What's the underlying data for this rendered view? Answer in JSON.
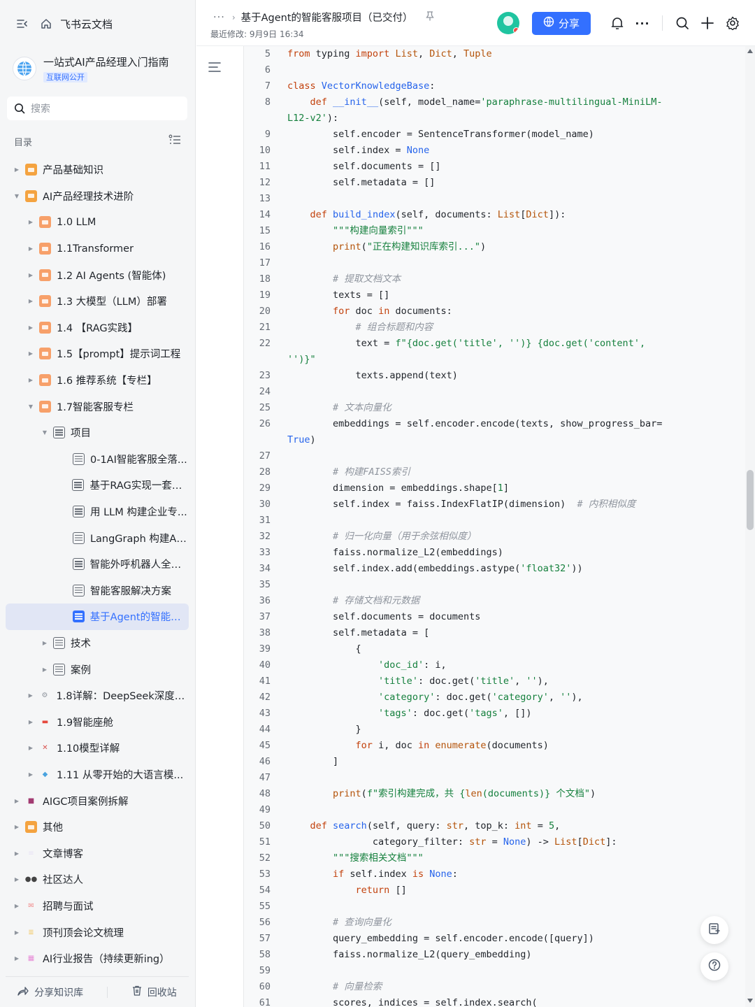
{
  "sidebar": {
    "brand": "飞书云文档",
    "workspace_title": "一站式AI产品经理入门指南",
    "workspace_badge": "互联网公开",
    "search_placeholder": "搜索",
    "toc_label": "目录",
    "items": [
      {
        "label": "产品基础知识",
        "level": 0,
        "expand": "collapsed",
        "icon": "folder-icon",
        "color": "#f4a340"
      },
      {
        "label": "AI产品经理技术进阶",
        "level": 0,
        "expand": "expanded",
        "icon": "folder-icon",
        "color": "#f4a340"
      },
      {
        "label": "1.0 LLM",
        "level": 1,
        "expand": "collapsed",
        "icon": "folder-icon",
        "color": "#f7a06a"
      },
      {
        "label": "1.1Transformer",
        "level": 1,
        "expand": "collapsed",
        "icon": "folder-icon",
        "color": "#f7a06a"
      },
      {
        "label": "1.2 AI Agents (智能体)",
        "level": 1,
        "expand": "collapsed",
        "icon": "folder-icon",
        "color": "#f7a06a"
      },
      {
        "label": "1.3 大模型（LLM）部署",
        "level": 1,
        "expand": "collapsed",
        "icon": "folder-icon",
        "color": "#f7a06a"
      },
      {
        "label": "1.4 【RAG实践】",
        "level": 1,
        "expand": "collapsed",
        "icon": "folder-icon",
        "color": "#f7a06a"
      },
      {
        "label": "1.5【prompt】提示词工程",
        "level": 1,
        "expand": "collapsed",
        "icon": "folder-icon",
        "color": "#f7a06a"
      },
      {
        "label": "1.6 推荐系统【专栏】",
        "level": 1,
        "expand": "collapsed",
        "icon": "folder-icon",
        "color": "#f7a06a"
      },
      {
        "label": "1.7智能客服专栏",
        "level": 1,
        "expand": "expanded",
        "icon": "folder-icon",
        "color": "#f7a06a"
      },
      {
        "label": "项目",
        "level": 2,
        "expand": "expanded",
        "icon": "doc-icon",
        "color": "#646a73"
      },
      {
        "label": "0-1AI智能客服全落...",
        "level": 3,
        "expand": "none",
        "icon": "doc-icon",
        "color": "#646a73"
      },
      {
        "label": "基于RAG实现一套企...",
        "level": 3,
        "expand": "none",
        "icon": "doc-icon",
        "color": "#646a73"
      },
      {
        "label": "用 LLM 构建企业专...",
        "level": 3,
        "expand": "none",
        "icon": "doc-icon",
        "color": "#646a73"
      },
      {
        "label": "LangGraph 构建AI...",
        "level": 3,
        "expand": "none",
        "icon": "doc-icon",
        "color": "#646a73"
      },
      {
        "label": "智能外呼机器人全链...",
        "level": 3,
        "expand": "none",
        "icon": "doc-icon",
        "color": "#646a73"
      },
      {
        "label": "智能客服解决方案",
        "level": 3,
        "expand": "none",
        "icon": "doc-icon",
        "color": "#646a73"
      },
      {
        "label": "基于Agent的智能客...",
        "level": 3,
        "expand": "none",
        "icon": "doc-icon",
        "color": "#3370ff",
        "active": true
      },
      {
        "label": "技术",
        "level": 2,
        "expand": "collapsed",
        "icon": "doc-icon",
        "color": "#646a73"
      },
      {
        "label": "案例",
        "level": 2,
        "expand": "collapsed",
        "icon": "doc-icon",
        "color": "#646a73"
      },
      {
        "label": "1.8详解：DeepSeek深度推...",
        "level": 1,
        "expand": "collapsed",
        "icon": "gear-icon",
        "color": "#8f959e"
      },
      {
        "label": "1.9智能座舱",
        "level": 1,
        "expand": "collapsed",
        "icon": "car-icon",
        "color": "#e5483d"
      },
      {
        "label": "1.10模型详解",
        "level": 1,
        "expand": "collapsed",
        "icon": "tools-icon",
        "color": "#d9534f"
      },
      {
        "label": "1.11 从零开始的大语言模...",
        "level": 1,
        "expand": "collapsed",
        "icon": "ufo-icon",
        "color": "#4aa3df"
      },
      {
        "label": "AIGC项目案例拆解",
        "level": 0,
        "expand": "collapsed",
        "icon": "floppy-icon",
        "color": "#a23b72"
      },
      {
        "label": "其他",
        "level": 0,
        "expand": "collapsed",
        "icon": "folder-icon",
        "color": "#f4a340"
      },
      {
        "label": "文章博客",
        "level": 0,
        "expand": "collapsed",
        "icon": "memo-icon",
        "color": "#e6e1f5"
      },
      {
        "label": "社区达人",
        "level": 0,
        "expand": "collapsed",
        "icon": "eyes-icon",
        "color": "#444444"
      },
      {
        "label": "招聘与面试",
        "level": 0,
        "expand": "collapsed",
        "icon": "mail-icon",
        "color": "#f08a8a"
      },
      {
        "label": "顶刊顶会论文梳理",
        "level": 0,
        "expand": "collapsed",
        "icon": "scroll-icon",
        "color": "#f3c969"
      },
      {
        "label": "AI行业报告（持续更新ing）",
        "level": 0,
        "expand": "collapsed",
        "icon": "grid-icon",
        "color": "#e78ad6"
      }
    ],
    "bottom": {
      "share_label": "分享知识库",
      "trash_label": "回收站"
    }
  },
  "header": {
    "breadcrumb_more": "···",
    "title": "基于Agent的智能客服项目（已交付）",
    "modified": "最近修改: 9月9日 16:34",
    "share_label": "分享",
    "more_label": "···"
  },
  "code_lines": [
    {
      "n": "5",
      "h": "<span class=\"k\">from</span> typing <span class=\"k\">import</span> <span class=\"t\">List</span>, <span class=\"t\">Dict</span>, <span class=\"t\">Tuple</span>"
    },
    {
      "n": "6",
      "h": ""
    },
    {
      "n": "7",
      "h": "<span class=\"k\">class</span> <span class=\"f\">VectorKnowledgeBase</span>:"
    },
    {
      "n": "8",
      "h": "    <span class=\"k\">def</span> <span class=\"f\">__init__</span>(self, model_name=<span class=\"s\">'paraphrase-multilingual-MiniLM-L12-v2'</span>):"
    },
    {
      "n": "9",
      "h": "        self.encoder = SentenceTransformer(model_name)"
    },
    {
      "n": "10",
      "h": "        self.index = <span class=\"n\">None</span>"
    },
    {
      "n": "11",
      "h": "        self.documents = []"
    },
    {
      "n": "12",
      "h": "        self.metadata = []"
    },
    {
      "n": "13",
      "h": ""
    },
    {
      "n": "14",
      "h": "    <span class=\"k\">def</span> <span class=\"f\">build_index</span>(self, documents: <span class=\"t\">List</span>[<span class=\"t\">Dict</span>]):"
    },
    {
      "n": "15",
      "h": "        <span class=\"s\">\"\"\"构建向量索引\"\"\"</span>"
    },
    {
      "n": "16",
      "h": "        <span class=\"t\">print</span>(<span class=\"s\">\"正在构建知识库索引...\"</span>)"
    },
    {
      "n": "17",
      "h": ""
    },
    {
      "n": "18",
      "h": "        <span class=\"c\"># 提取文档文本</span>"
    },
    {
      "n": "19",
      "h": "        texts = []"
    },
    {
      "n": "20",
      "h": "        <span class=\"k\">for</span> doc <span class=\"k\">in</span> documents:"
    },
    {
      "n": "21",
      "h": "            <span class=\"c\"># 组合标题和内容</span>"
    },
    {
      "n": "22",
      "h": "            text = <span class=\"s\">f\"{doc.get('title', '')} {doc.get('content', '')}\"</span>"
    },
    {
      "n": "23",
      "h": "            texts.append(text)"
    },
    {
      "n": "24",
      "h": ""
    },
    {
      "n": "25",
      "h": "        <span class=\"c\"># 文本向量化</span>"
    },
    {
      "n": "26",
      "h": "        embeddings = self.encoder.encode(texts, show_progress_bar=<span class=\"n\">True</span>)"
    },
    {
      "n": "27",
      "h": ""
    },
    {
      "n": "28",
      "h": "        <span class=\"c\"># 构建FAISS索引</span>"
    },
    {
      "n": "29",
      "h": "        dimension = embeddings.shape[<span class=\"s\">1</span>]"
    },
    {
      "n": "30",
      "h": "        self.index = faiss.IndexFlatIP(dimension)  <span class=\"c\"># 内积相似度</span>"
    },
    {
      "n": "31",
      "h": ""
    },
    {
      "n": "32",
      "h": "        <span class=\"c\"># 归一化向量（用于余弦相似度）</span>"
    },
    {
      "n": "33",
      "h": "        faiss.normalize_L2(embeddings)"
    },
    {
      "n": "34",
      "h": "        self.index.add(embeddings.astype(<span class=\"s\">'float32'</span>))"
    },
    {
      "n": "35",
      "h": ""
    },
    {
      "n": "36",
      "h": "        <span class=\"c\"># 存储文档和元数据</span>"
    },
    {
      "n": "37",
      "h": "        self.documents = documents"
    },
    {
      "n": "38",
      "h": "        self.metadata = ["
    },
    {
      "n": "39",
      "h": "            {"
    },
    {
      "n": "40",
      "h": "                <span class=\"s\">'doc_id'</span>: i,"
    },
    {
      "n": "41",
      "h": "                <span class=\"s\">'title'</span>: doc.get(<span class=\"s\">'title'</span>, <span class=\"s\">''</span>),"
    },
    {
      "n": "42",
      "h": "                <span class=\"s\">'category'</span>: doc.get(<span class=\"s\">'category'</span>, <span class=\"s\">''</span>),"
    },
    {
      "n": "43",
      "h": "                <span class=\"s\">'tags'</span>: doc.get(<span class=\"s\">'tags'</span>, [])"
    },
    {
      "n": "44",
      "h": "            }"
    },
    {
      "n": "45",
      "h": "            <span class=\"k\">for</span> i, doc <span class=\"k\">in</span> <span class=\"t\">enumerate</span>(documents)"
    },
    {
      "n": "46",
      "h": "        ]"
    },
    {
      "n": "47",
      "h": ""
    },
    {
      "n": "48",
      "h": "        <span class=\"t\">print</span>(<span class=\"s\">f\"索引构建完成，共 {</span><span class=\"t\">len</span><span class=\"s\">(documents)} 个文档\"</span>)"
    },
    {
      "n": "49",
      "h": ""
    },
    {
      "n": "50",
      "h": "    <span class=\"k\">def</span> <span class=\"f\">search</span>(self, query: <span class=\"t\">str</span>, top_k: <span class=\"t\">int</span> = <span class=\"s\">5</span>,"
    },
    {
      "n": "51",
      "h": "               category_filter: <span class=\"t\">str</span> = <span class=\"n\">None</span>) -&gt; <span class=\"t\">List</span>[<span class=\"t\">Dict</span>]:"
    },
    {
      "n": "52",
      "h": "        <span class=\"s\">\"\"\"搜索相关文档\"\"\"</span>"
    },
    {
      "n": "53",
      "h": "        <span class=\"k\">if</span> self.index <span class=\"k\">is</span> <span class=\"n\">None</span>:"
    },
    {
      "n": "54",
      "h": "            <span class=\"k\">return</span> []"
    },
    {
      "n": "55",
      "h": ""
    },
    {
      "n": "56",
      "h": "        <span class=\"c\"># 查询向量化</span>"
    },
    {
      "n": "57",
      "h": "        query_embedding = self.encoder.encode([query])"
    },
    {
      "n": "58",
      "h": "        faiss.normalize_L2(query_embedding)"
    },
    {
      "n": "59",
      "h": ""
    },
    {
      "n": "60",
      "h": "        <span class=\"c\"># 向量检索</span>"
    },
    {
      "n": "61",
      "h": "        scores, indices = self.index.search("
    }
  ],
  "scroll_position": 0.47,
  "colors": {
    "accent": "#3370ff",
    "sidebar_bg": "#f5f6f7"
  }
}
